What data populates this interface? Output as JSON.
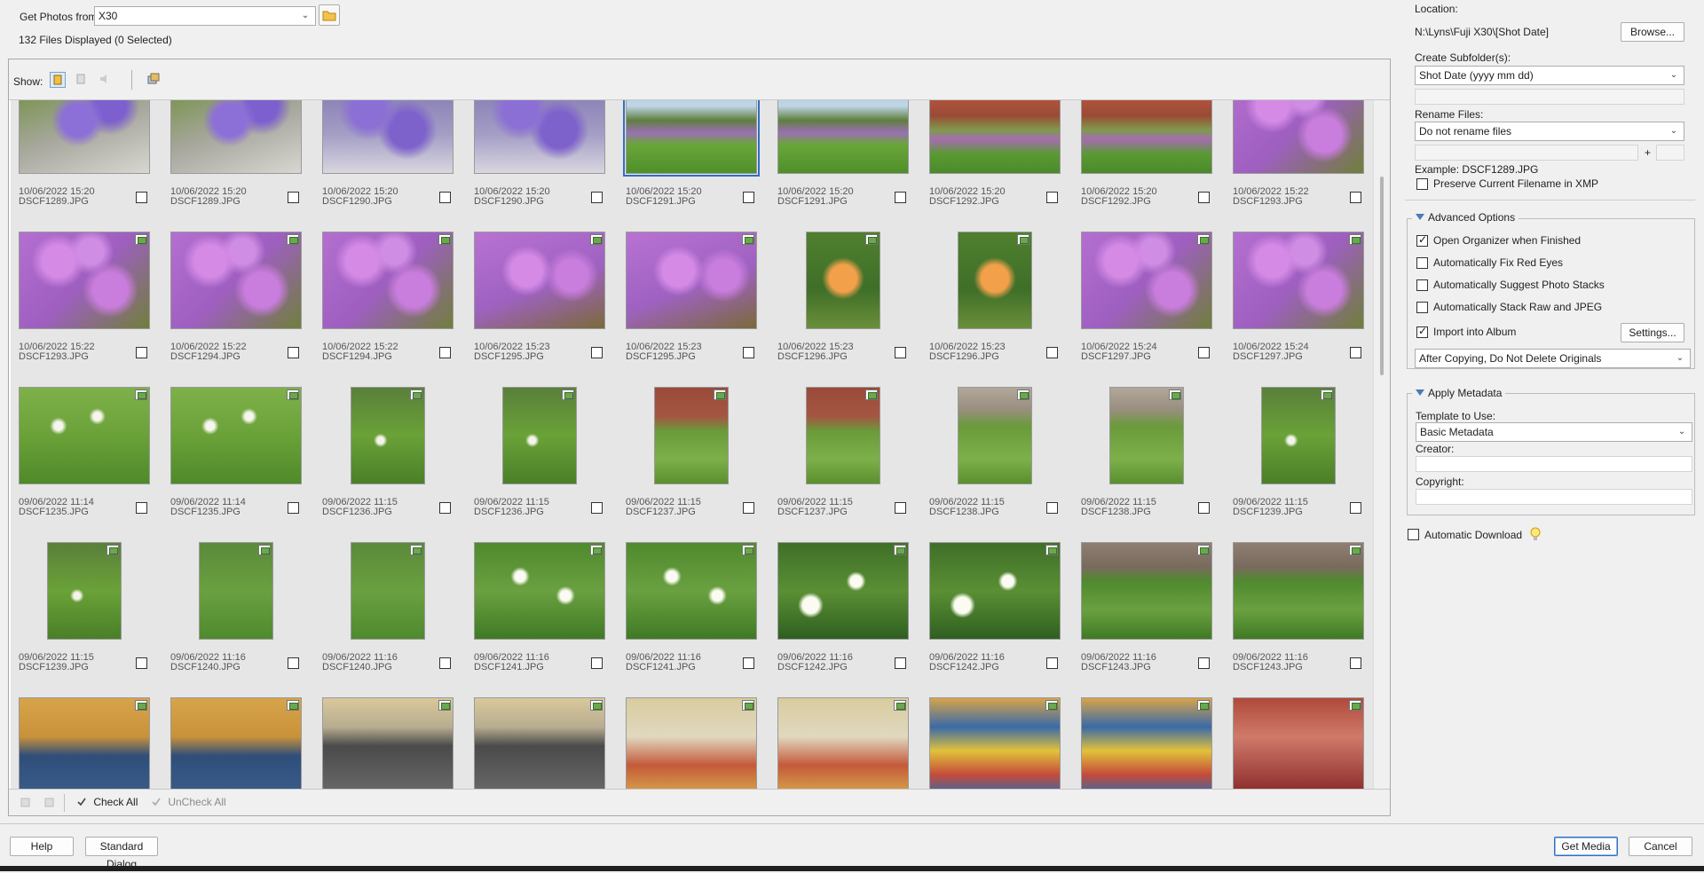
{
  "source": {
    "label": "Get Photos from:",
    "value": "X30",
    "files_status": "132 Files Displayed (0 Selected)"
  },
  "show": {
    "label": "Show:"
  },
  "grid": {
    "rows": [
      [
        {
          "date": "10/06/2022 15:20",
          "name": "DSCF1289.JPG",
          "orient": "land",
          "scene": "campanula"
        },
        {
          "date": "10/06/2022 15:20",
          "name": "DSCF1289.JPG",
          "orient": "land",
          "scene": "campanula"
        },
        {
          "date": "10/06/2022 15:20",
          "name": "DSCF1290.JPG",
          "orient": "land",
          "scene": "campanula2"
        },
        {
          "date": "10/06/2022 15:20",
          "name": "DSCF1290.JPG",
          "orient": "land",
          "scene": "campanula2"
        },
        {
          "date": "10/06/2022 15:20",
          "name": "DSCF1291.JPG",
          "orient": "land",
          "scene": "garden",
          "selected": true
        },
        {
          "date": "10/06/2022 15:20",
          "name": "DSCF1291.JPG",
          "orient": "land",
          "scene": "garden"
        },
        {
          "date": "10/06/2022 15:20",
          "name": "DSCF1292.JPG",
          "orient": "land",
          "scene": "house"
        },
        {
          "date": "10/06/2022 15:20",
          "name": "DSCF1292.JPG",
          "orient": "land",
          "scene": "house"
        },
        {
          "date": "10/06/2022 15:22",
          "name": "DSCF1293.JPG",
          "orient": "land",
          "scene": "geranium"
        }
      ],
      [
        {
          "date": "10/06/2022 15:22",
          "name": "DSCF1293.JPG",
          "orient": "land",
          "scene": "geranium"
        },
        {
          "date": "10/06/2022 15:22",
          "name": "DSCF1294.JPG",
          "orient": "land",
          "scene": "geranium"
        },
        {
          "date": "10/06/2022 15:22",
          "name": "DSCF1294.JPG",
          "orient": "land",
          "scene": "geranium"
        },
        {
          "date": "10/06/2022 15:23",
          "name": "DSCF1295.JPG",
          "orient": "land",
          "scene": "geranium2"
        },
        {
          "date": "10/06/2022 15:23",
          "name": "DSCF1295.JPG",
          "orient": "land",
          "scene": "geranium2"
        },
        {
          "date": "10/06/2022 15:23",
          "name": "DSCF1296.JPG",
          "orient": "port",
          "scene": "rose"
        },
        {
          "date": "10/06/2022 15:23",
          "name": "DSCF1296.JPG",
          "orient": "port",
          "scene": "rose"
        },
        {
          "date": "10/06/2022 15:24",
          "name": "DSCF1297.JPG",
          "orient": "land",
          "scene": "geranium"
        },
        {
          "date": "10/06/2022 15:24",
          "name": "DSCF1297.JPG",
          "orient": "land",
          "scene": "geranium"
        }
      ],
      [
        {
          "date": "09/06/2022 11:14",
          "name": "DSCF1235.JPG",
          "orient": "land",
          "scene": "whitefl"
        },
        {
          "date": "09/06/2022 11:14",
          "name": "DSCF1235.JPG",
          "orient": "land",
          "scene": "whitefl"
        },
        {
          "date": "09/06/2022 11:15",
          "name": "DSCF1236.JPG",
          "orient": "port",
          "scene": "whitefl2"
        },
        {
          "date": "09/06/2022 11:15",
          "name": "DSCF1236.JPG",
          "orient": "port",
          "scene": "whitefl2"
        },
        {
          "date": "09/06/2022 11:15",
          "name": "DSCF1237.JPG",
          "orient": "port",
          "scene": "wall"
        },
        {
          "date": "09/06/2022 11:15",
          "name": "DSCF1237.JPG",
          "orient": "port",
          "scene": "wall"
        },
        {
          "date": "09/06/2022 11:15",
          "name": "DSCF1238.JPG",
          "orient": "port",
          "scene": "wall2"
        },
        {
          "date": "09/06/2022 11:15",
          "name": "DSCF1238.JPG",
          "orient": "port",
          "scene": "wall2"
        },
        {
          "date": "09/06/2022 11:15",
          "name": "DSCF1239.JPG",
          "orient": "port",
          "scene": "whitefl2"
        }
      ],
      [
        {
          "date": "09/06/2022 11:15",
          "name": "DSCF1239.JPG",
          "orient": "port",
          "scene": "whitefl2"
        },
        {
          "date": "09/06/2022 11:16",
          "name": "DSCF1240.JPG",
          "orient": "port",
          "scene": "grass"
        },
        {
          "date": "09/06/2022 11:16",
          "name": "DSCF1240.JPG",
          "orient": "port",
          "scene": "grass"
        },
        {
          "date": "09/06/2022 11:16",
          "name": "DSCF1241.JPG",
          "orient": "land",
          "scene": "daisy"
        },
        {
          "date": "09/06/2022 11:16",
          "name": "DSCF1241.JPG",
          "orient": "land",
          "scene": "daisy"
        },
        {
          "date": "09/06/2022 11:16",
          "name": "DSCF1242.JPG",
          "orient": "land",
          "scene": "daisy2"
        },
        {
          "date": "09/06/2022 11:16",
          "name": "DSCF1242.JPG",
          "orient": "land",
          "scene": "daisy2"
        },
        {
          "date": "09/06/2022 11:16",
          "name": "DSCF1243.JPG",
          "orient": "land",
          "scene": "daisy3"
        },
        {
          "date": "09/06/2022 11:16",
          "name": "DSCF1243.JPG",
          "orient": "land",
          "scene": "daisy3"
        }
      ],
      [
        {
          "date": "",
          "name": "",
          "orient": "land",
          "scene": "album1"
        },
        {
          "date": "",
          "name": "",
          "orient": "land",
          "scene": "album1"
        },
        {
          "date": "",
          "name": "",
          "orient": "land",
          "scene": "album2"
        },
        {
          "date": "",
          "name": "",
          "orient": "land",
          "scene": "album2"
        },
        {
          "date": "",
          "name": "",
          "orient": "land",
          "scene": "album3"
        },
        {
          "date": "",
          "name": "",
          "orient": "land",
          "scene": "album3"
        },
        {
          "date": "",
          "name": "",
          "orient": "land",
          "scene": "album4"
        },
        {
          "date": "",
          "name": "",
          "orient": "land",
          "scene": "album4"
        },
        {
          "date": "",
          "name": "",
          "orient": "land",
          "scene": "album5"
        }
      ]
    ]
  },
  "bottom_bar": {
    "check_all": "Check All",
    "uncheck_all": "UnCheck All"
  },
  "right": {
    "location_label": "Location:",
    "location_value": "N:\\Lyns\\Fuji X30\\[Shot Date]",
    "browse": "Browse...",
    "subfolder_label": "Create Subfolder(s):",
    "subfolder_value": "Shot Date (yyyy mm dd)",
    "rename_label": "Rename Files:",
    "rename_value": "Do not rename files",
    "plus": "+",
    "example": "Example:  DSCF1289.JPG",
    "preserve": "Preserve Current Filename in XMP",
    "advanced": {
      "title": "Advanced Options",
      "open_organizer": "Open Organizer when Finished",
      "fix_red_eyes": "Automatically Fix Red Eyes",
      "suggest_stacks": "Automatically Suggest Photo Stacks",
      "stack_raw": "Automatically Stack Raw and JPEG",
      "import_album": "Import into Album",
      "settings": "Settings...",
      "after_copying": "After Copying, Do Not Delete Originals"
    },
    "metadata": {
      "title": "Apply Metadata",
      "template_label": "Template to Use:",
      "template_value": "Basic Metadata",
      "creator_label": "Creator:",
      "copyright_label": "Copyright:"
    },
    "auto_download": "Automatic Download"
  },
  "footer": {
    "help": "Help",
    "standard": "Standard Dialog",
    "get_media": "Get Media",
    "cancel": "Cancel"
  }
}
